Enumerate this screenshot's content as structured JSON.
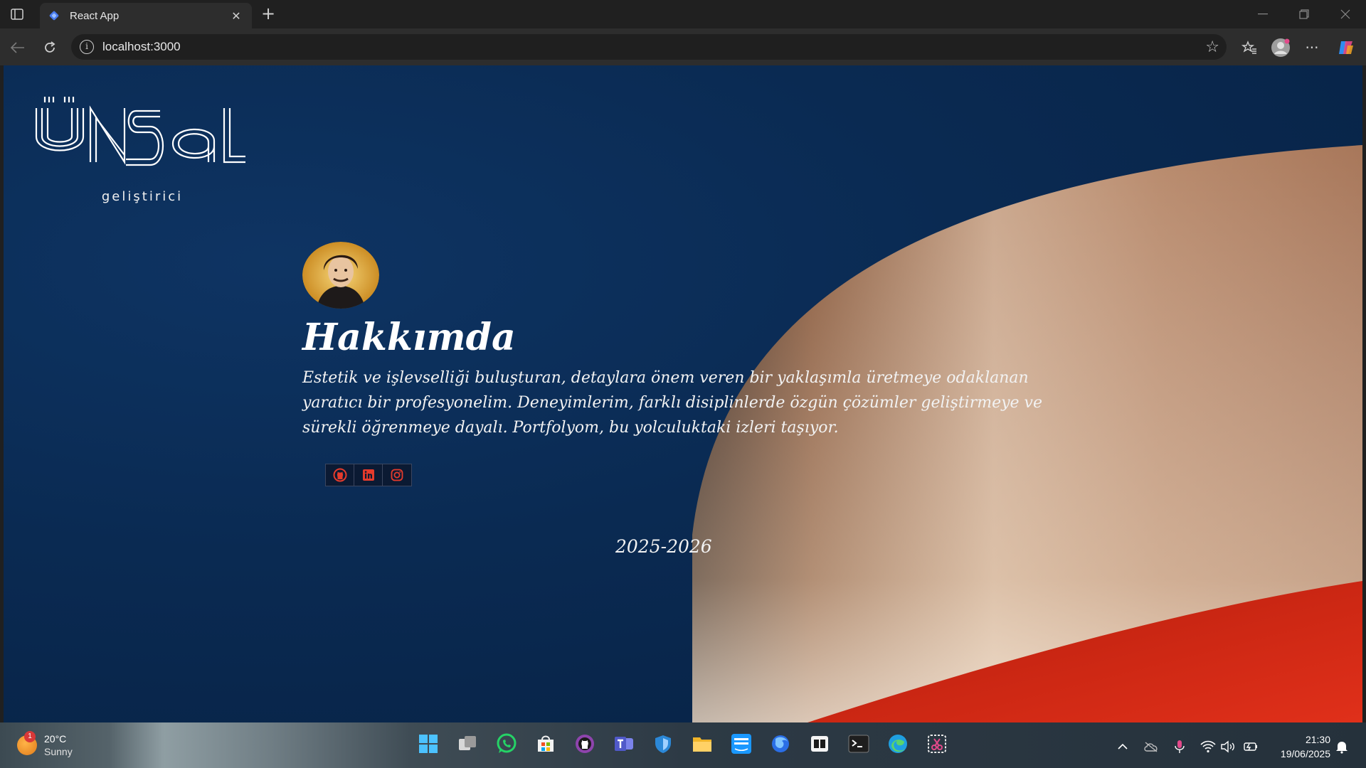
{
  "browser": {
    "tab": {
      "title": "React App"
    },
    "address": {
      "url": "localhost:3000"
    }
  },
  "page": {
    "logo": {
      "text": "ÜNSAL",
      "subtitle": "geliştirici"
    },
    "about": {
      "title": "Hakkımda",
      "text": "Estetik ve işlevselliği buluşturan, detaylara önem veren bir yaklaşımla üretmeye odaklanan yaratıcı bir profesyonelim. Deneyimlerim, farklı disiplinlerde özgün çözümler geliştirmeye ve sürekli öğrenmeye dayalı. Portfolyom, bu yolculuktaki izleri taşıyor."
    },
    "socials": [
      {
        "name": "github-icon"
      },
      {
        "name": "linkedin-icon"
      },
      {
        "name": "instagram-icon"
      }
    ],
    "years": "2025-2026",
    "colors": {
      "background": "#0a2a52",
      "accent_red": "#d42a10",
      "icon_red": "#e53b2c"
    }
  },
  "taskbar": {
    "weather": {
      "temp": "20°C",
      "condition": "Sunny",
      "badge": "1"
    },
    "clock": {
      "time": "21:30",
      "date": "19/06/2025"
    }
  }
}
